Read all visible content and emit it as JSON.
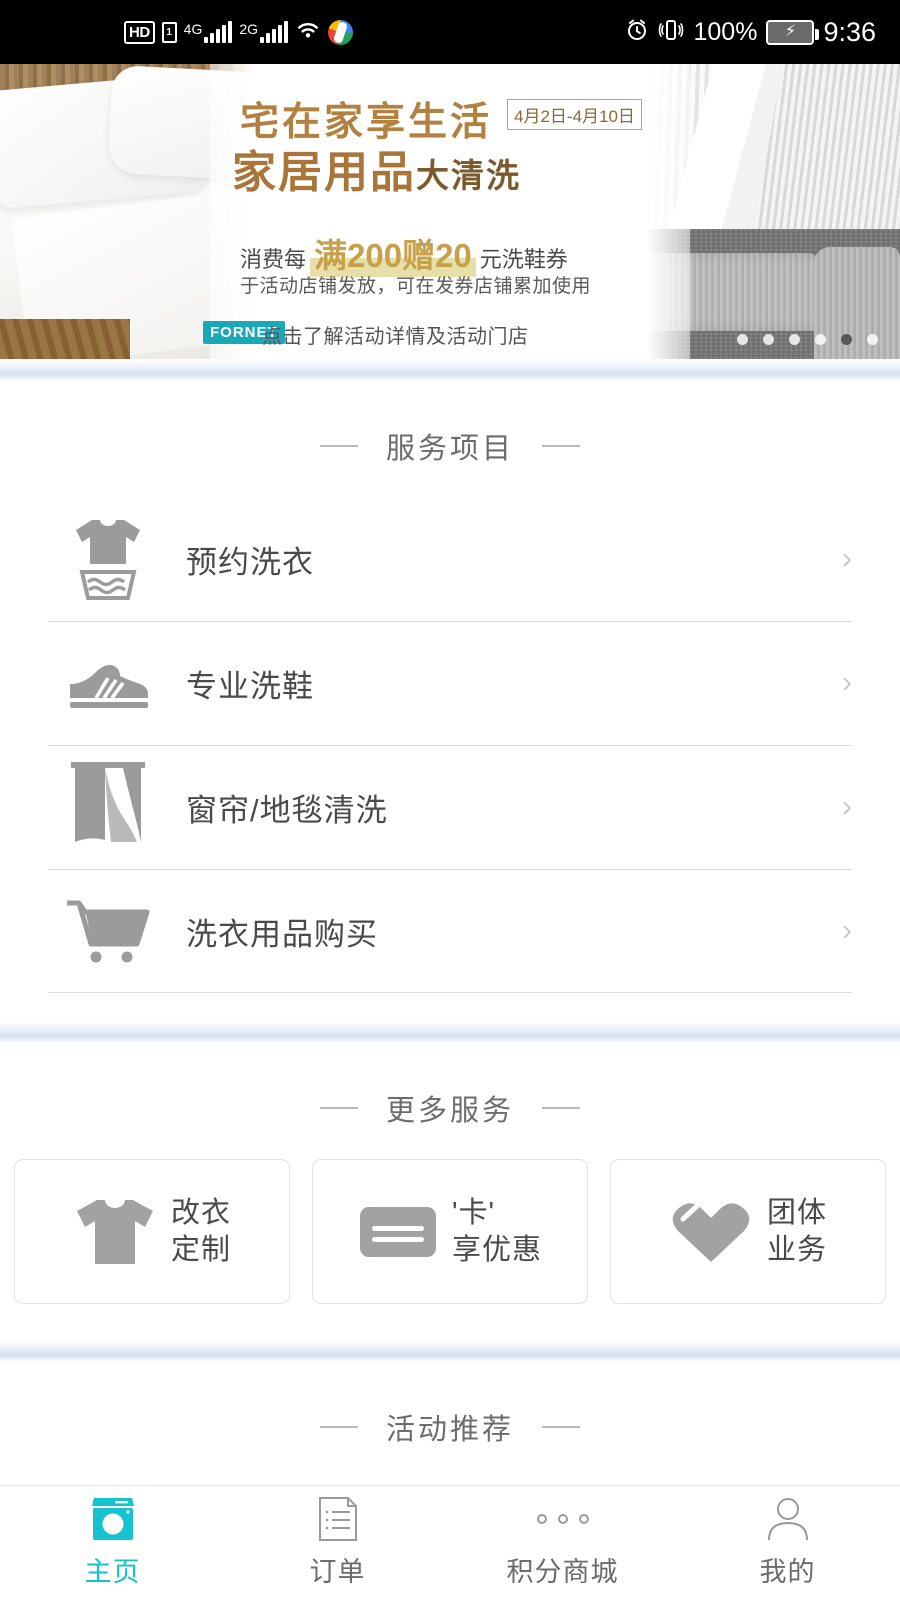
{
  "statusbar": {
    "hd_badge": "HD",
    "sim_badge": "1",
    "net_4g": "4G",
    "net_4g_sup": "+",
    "net_2g": "2G",
    "wifi_icon": "wifi-icon",
    "app_icon": "google-photos-icon",
    "alarm_icon": "alarm-clock-icon",
    "vibrate_icon": "vibrate-icon",
    "battery_percent": "100%",
    "battery_icon": "battery-charging-icon",
    "clock": "9:36"
  },
  "banner": {
    "headline1": "宅在家享生活",
    "date_badge": "4月2日-4月10日",
    "headline2_main": "家居用品",
    "headline2_tail": "大清洗",
    "promo_prefix": "消费每",
    "promo_highlight": "满200赠20",
    "promo_suffix": "元洗鞋券",
    "subtitle": "于活动店铺发放，可在发券店铺累加使用",
    "brand_logo": "FORNET",
    "cta": "点击了解活动详情及活动门店",
    "dots_total": 6,
    "dots_active_index": 4
  },
  "services_section": {
    "title": "服务项目",
    "items": [
      {
        "label": "预约洗衣",
        "icon": "tshirt-wash-icon",
        "chevron": "›"
      },
      {
        "label": "专业洗鞋",
        "icon": "shoe-icon",
        "chevron": "›"
      },
      {
        "label": "窗帘/地毯清洗",
        "icon": "curtain-icon",
        "chevron": "›"
      },
      {
        "label": "洗衣用品购买",
        "icon": "shopping-cart-icon",
        "chevron": "›"
      }
    ]
  },
  "more_section": {
    "title": "更多服务",
    "cards": [
      {
        "line1": "改衣",
        "line2": "定制",
        "icon": "tshirt-icon"
      },
      {
        "line1": "'卡'",
        "line2": "享优惠",
        "icon": "card-icon"
      },
      {
        "line1": "团体",
        "line2": "业务",
        "icon": "heart-icon"
      }
    ]
  },
  "activity_section": {
    "title": "活动推荐"
  },
  "tabbar": {
    "items": [
      {
        "label": "主页",
        "icon": "washing-machine-icon",
        "active": true
      },
      {
        "label": "订单",
        "icon": "order-list-icon",
        "active": false
      },
      {
        "label": "积分商城",
        "icon": "points-mall-icon",
        "active": false
      },
      {
        "label": "我的",
        "icon": "person-icon",
        "active": false
      }
    ]
  },
  "colors": {
    "accent": "#16c2ce",
    "banner_gold": "#b3813f",
    "text_primary": "#4a4a4a",
    "text_secondary": "#6d6d6d",
    "divider": "#dcdcdc"
  }
}
